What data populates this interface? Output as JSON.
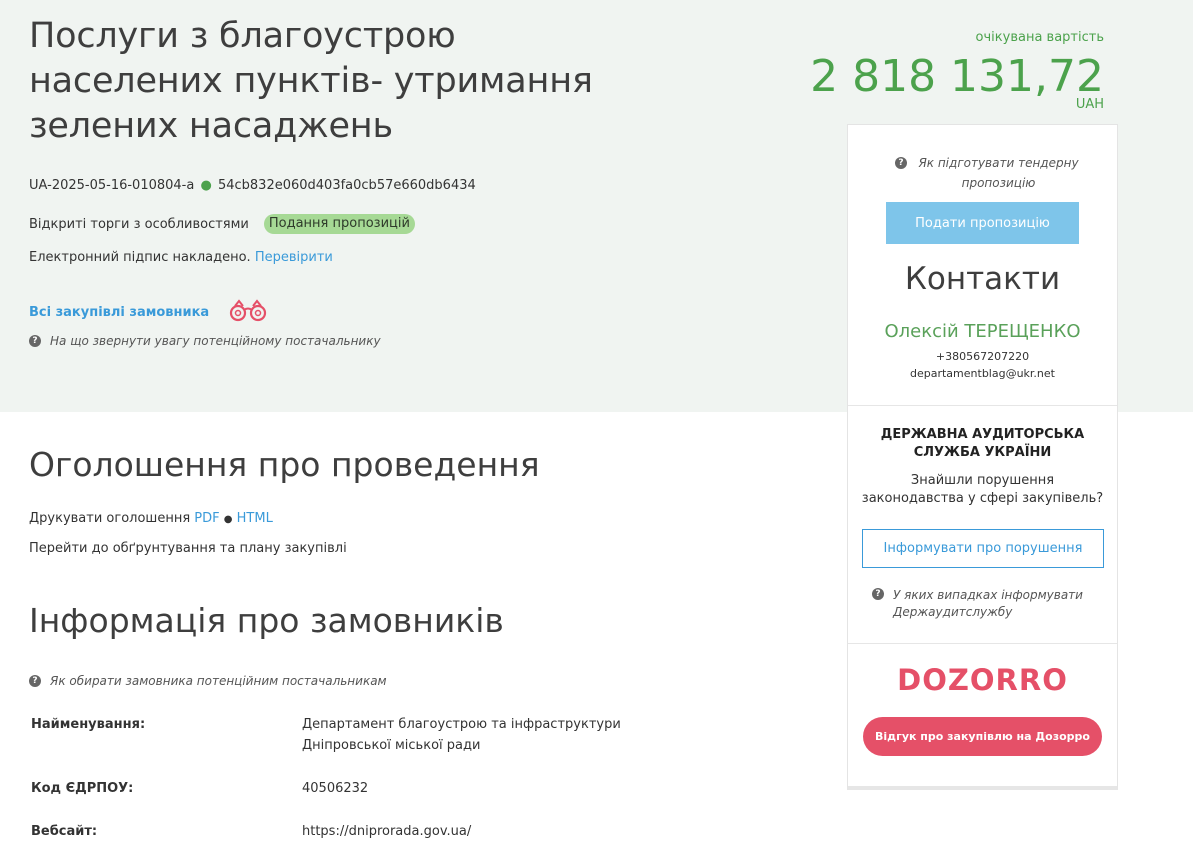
{
  "tender": {
    "title": "Послуги з благоустрою населених пунктів- утримання зелених насаджень",
    "id": "UA-2025-05-16-010804-a",
    "hash": "54cb832e060d403fa0cb57e660db6434",
    "procedure_type": "Відкриті торги з особливостями",
    "status_badge": "Подання пропозицій",
    "signature_text": "Електронний підпис накладено.",
    "signature_link": "Перевірити",
    "all_purchases_link": "Всі закупівлі замовника",
    "supplier_hint": "На що звернути увагу потенційному постачальнику"
  },
  "price": {
    "label": "очікувана вартість",
    "value": "2 818 131,72",
    "currency": "UAH"
  },
  "announcement": {
    "heading": "Оголошення про проведення",
    "print_label": "Друкувати оголошення",
    "pdf_link": "PDF",
    "separator": "●",
    "html_link": "HTML",
    "plan_link": "Перейти до обґрунтування та плану закупівлі"
  },
  "customers": {
    "heading": "Інформація про замовників",
    "hint": "Як обирати замовника потенційним постачальникам",
    "fields": [
      {
        "label": "Найменування:",
        "value": "Департамент благоустрою та інфраструктури Дніпровської міської ради"
      },
      {
        "label": "Код ЄДРПОУ:",
        "value": "40506232"
      },
      {
        "label": "Вебсайт:",
        "value": "https://dniprorada.gov.ua/"
      }
    ]
  },
  "sidebar": {
    "hint_prepare": "Як підготувати тендерну пропозицію",
    "submit_button": "Подати пропозицію",
    "contacts_title": "Контакти",
    "contact_name": "Олексій ТЕРЕЩЕНКО",
    "contact_phone": "+380567207220",
    "contact_email": "departamentblag@ukr.net",
    "audit_title": "ДЕРЖАВНА АУДИТОРСЬКА СЛУЖБА УКРАЇНИ",
    "audit_text": "Знайшли порушення законодавства у сфері закупівель?",
    "report_button": "Інформувати про порушення",
    "audit_hint": "У яких випадках інформувати Держаудитслужбу",
    "dozorro_logo": "DOZORRO",
    "dozorro_button": "Відгук про закупівлю на Дозорро"
  },
  "colors": {
    "accent_green": "#4ca24c",
    "link_blue": "#3a9ad9",
    "badge_green": "#a6d995",
    "submit_blue": "#7ec5ea",
    "dozorro_red": "#e55068",
    "top_band": "#f0f4f1"
  }
}
